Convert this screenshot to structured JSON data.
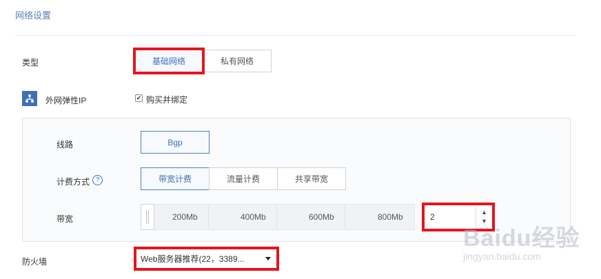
{
  "section": {
    "title": "网络设置"
  },
  "type_row": {
    "label": "类型",
    "options": [
      {
        "label": "基础网络",
        "active": true
      },
      {
        "label": "私有网络",
        "active": false
      }
    ]
  },
  "eip_row": {
    "label": "外网弹性IP",
    "checkbox_label": "购买并绑定",
    "checked": true
  },
  "line_row": {
    "label": "线路",
    "options": [
      {
        "label": "Bgp",
        "active": true
      }
    ]
  },
  "billing_row": {
    "label": "计费方式",
    "help": "?",
    "options": [
      {
        "label": "带宽计费",
        "active": true
      },
      {
        "label": "流量计费",
        "active": false
      },
      {
        "label": "共享带宽",
        "active": false
      }
    ]
  },
  "bandwidth_row": {
    "label": "带宽",
    "ticks": [
      "200Mb",
      "400Mb",
      "600Mb",
      "800Mb"
    ],
    "value": "2",
    "stepper_up": "▲",
    "stepper_down": "▼"
  },
  "firewall_row": {
    "label": "防火墙",
    "selected": "Web服务器推荐(22，3389..."
  },
  "watermark": {
    "logo": "Baidu经验",
    "url": "jingyan.baidu.com"
  },
  "colors": {
    "accent": "#3f6fb9",
    "highlight": "#e6141e",
    "title": "#5a7fb8"
  }
}
